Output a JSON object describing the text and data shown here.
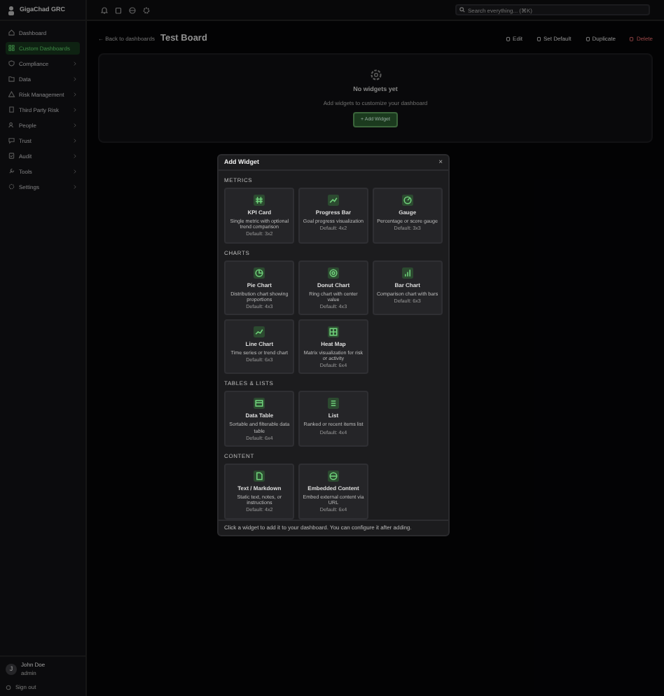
{
  "app": {
    "name": "GigaChad GRC"
  },
  "sidebar": {
    "items": [
      {
        "label": "Dashboard",
        "selected": false,
        "expandable": false
      },
      {
        "label": "Custom Dashboards",
        "selected": true,
        "expandable": false
      },
      {
        "label": "Compliance",
        "selected": false,
        "expandable": true
      },
      {
        "label": "Data",
        "selected": false,
        "expandable": true
      },
      {
        "label": "Risk Management",
        "selected": false,
        "expandable": true
      },
      {
        "label": "Third Party Risk",
        "selected": false,
        "expandable": true
      },
      {
        "label": "People",
        "selected": false,
        "expandable": true
      },
      {
        "label": "Trust",
        "selected": false,
        "expandable": true
      },
      {
        "label": "Audit",
        "selected": false,
        "expandable": true
      },
      {
        "label": "Tools",
        "selected": false,
        "expandable": true
      },
      {
        "label": "Settings",
        "selected": false,
        "expandable": true
      }
    ],
    "user": {
      "initial": "J",
      "name": "John Doe",
      "role": "admin"
    },
    "sign_out": "Sign out"
  },
  "topbar": {
    "search_placeholder": "Search everything... (⌘K)"
  },
  "header": {
    "back": "← Back to dashboards",
    "title": "Test Board",
    "actions": [
      {
        "label": "Edit",
        "kind": "normal"
      },
      {
        "label": "Set Default",
        "kind": "normal"
      },
      {
        "label": "Duplicate",
        "kind": "normal"
      },
      {
        "label": "Delete",
        "kind": "danger"
      }
    ]
  },
  "empty_state": {
    "title": "No widgets yet",
    "subtitle": "Add widgets to customize your dashboard",
    "button": "+ Add Widget"
  },
  "modal": {
    "title": "Add Widget",
    "close": "×",
    "sections": [
      {
        "heading": "METRICS",
        "widgets": [
          {
            "name": "KPI Card",
            "description": "Single metric with optional trend comparison",
            "size": "Default: 3x2"
          },
          {
            "name": "Progress Bar",
            "description": "Goal progress visualization",
            "size": "Default: 4x2"
          },
          {
            "name": "Gauge",
            "description": "Percentage or score gauge",
            "size": "Default: 3x3"
          }
        ]
      },
      {
        "heading": "CHARTS",
        "widgets": [
          {
            "name": "Pie Chart",
            "description": "Distribution chart showing proportions",
            "size": "Default: 4x3"
          },
          {
            "name": "Donut Chart",
            "description": "Ring chart with center value",
            "size": "Default: 4x3"
          },
          {
            "name": "Bar Chart",
            "description": "Comparison chart with bars",
            "size": "Default: 6x3"
          },
          {
            "name": "Line Chart",
            "description": "Time series or trend chart",
            "size": "Default: 6x3"
          },
          {
            "name": "Heat Map",
            "description": "Matrix visualization for risk or activity",
            "size": "Default: 6x4"
          }
        ]
      },
      {
        "heading": "TABLES & LISTS",
        "widgets": [
          {
            "name": "Data Table",
            "description": "Sortable and filterable data table",
            "size": "Default: 6x4"
          },
          {
            "name": "List",
            "description": "Ranked or recent items list",
            "size": "Default: 4x4"
          }
        ]
      },
      {
        "heading": "CONTENT",
        "widgets": [
          {
            "name": "Text / Markdown",
            "description": "Static text, notes, or instructions",
            "size": "Default: 4x2"
          },
          {
            "name": "Embedded Content",
            "description": "Embed external content via URL",
            "size": "Default: 6x4"
          }
        ]
      }
    ],
    "footer": "Click a widget to add it to your dashboard. You can configure it after adding."
  }
}
